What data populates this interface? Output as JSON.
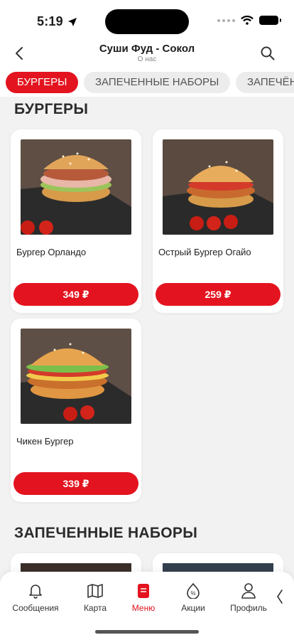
{
  "status_bar": {
    "time": "5:19"
  },
  "header": {
    "title": "Суши Фуд - Сокол",
    "subtitle": "О нас"
  },
  "tabs": [
    {
      "label": "БУРГЕРЫ",
      "active": true
    },
    {
      "label": "ЗАПЕЧЕННЫЕ НАБОРЫ",
      "active": false
    },
    {
      "label": "ЗАПЕЧЁН",
      "active": false
    }
  ],
  "sections": [
    {
      "title": "БУРГЕРЫ",
      "items": [
        {
          "name": "Бургер Орландо",
          "price": "349 ₽"
        },
        {
          "name": "Острый Бургер Огайо",
          "price": "259 ₽"
        },
        {
          "name": "Чикен Бургер",
          "price": "339 ₽"
        }
      ]
    },
    {
      "title": "ЗАПЕЧЕННЫЕ НАБОРЫ"
    }
  ],
  "nav": {
    "items": [
      {
        "label": "Сообщения",
        "icon": "bell-icon"
      },
      {
        "label": "Карта",
        "icon": "map-icon"
      },
      {
        "label": "Меню",
        "icon": "menu-icon",
        "active": true
      },
      {
        "label": "Акции",
        "icon": "discount-icon"
      },
      {
        "label": "Профиль",
        "icon": "profile-icon"
      }
    ]
  },
  "colors": {
    "accent": "#e3141f",
    "background": "#f2f2f2",
    "card": "#ffffff"
  }
}
